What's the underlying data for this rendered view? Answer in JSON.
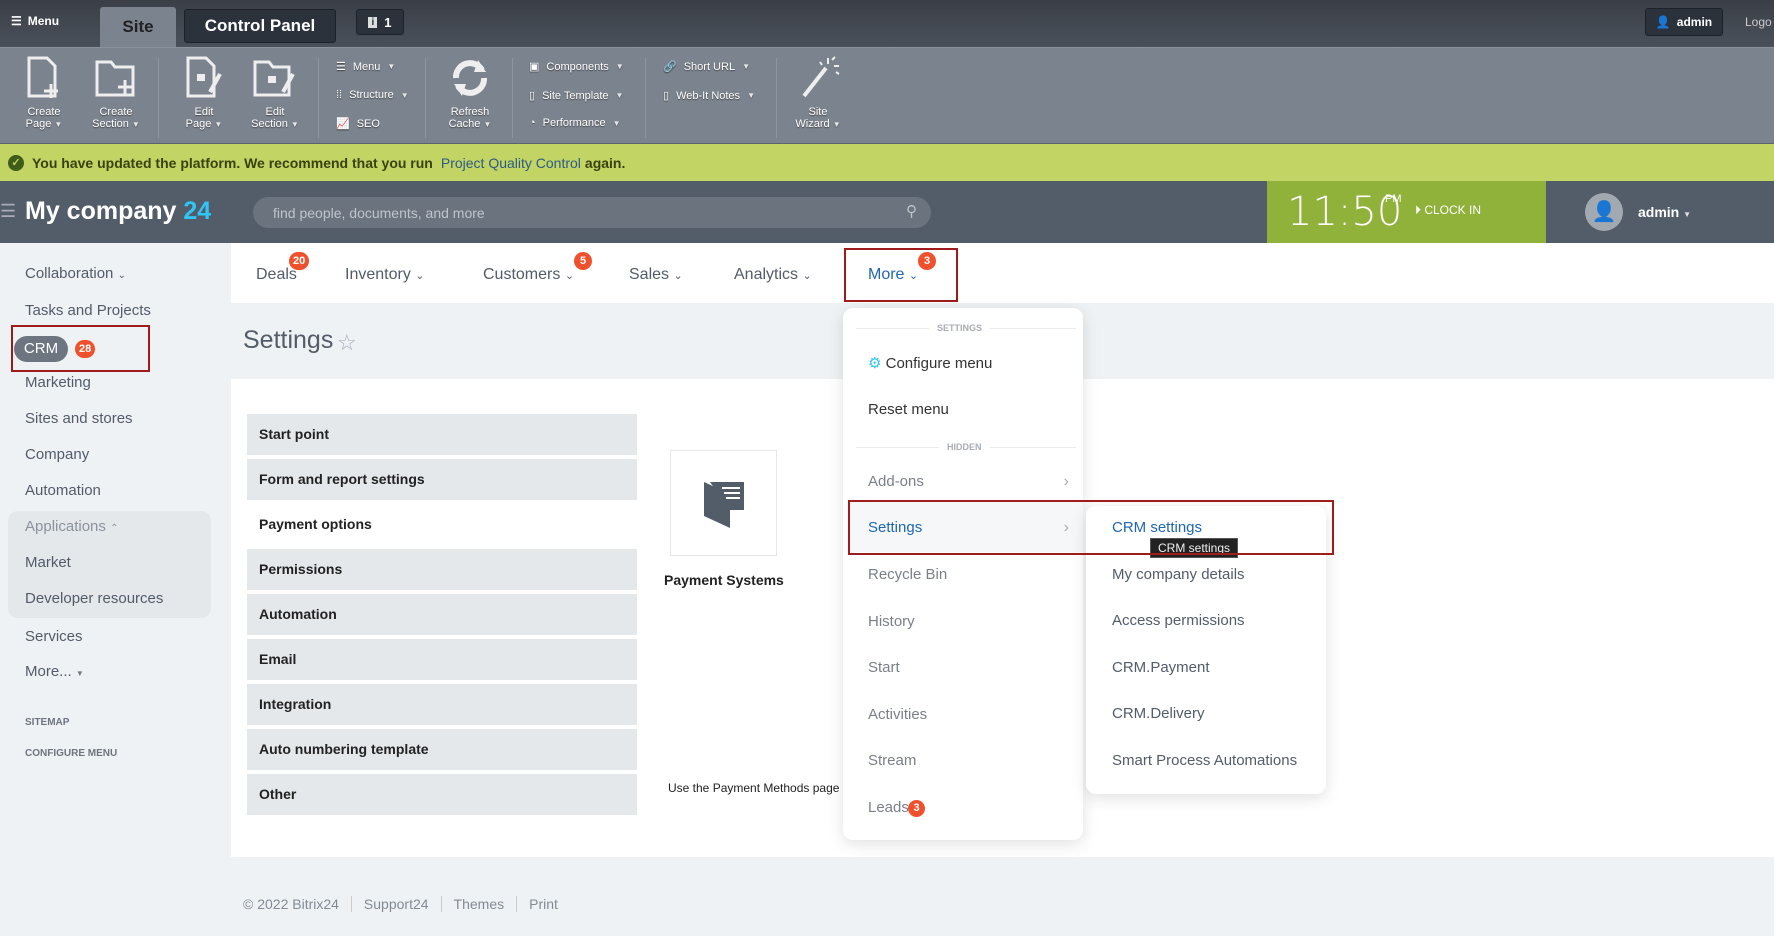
{
  "admin_bar": {
    "menu": "Menu",
    "tab_site": "Site",
    "tab_control_panel": "Control Panel",
    "notifications": "1",
    "user": "admin",
    "logout": "Logo"
  },
  "toolbar": {
    "create_page": [
      "Create",
      "Page"
    ],
    "create_section": [
      "Create",
      "Section"
    ],
    "edit_page": [
      "Edit",
      "Page"
    ],
    "edit_section": [
      "Edit",
      "Section"
    ],
    "menu": "Menu",
    "structure": "Structure",
    "seo": "SEO",
    "refresh_cache": [
      "Refresh",
      "Cache"
    ],
    "components": "Components",
    "site_template": "Site Template",
    "performance": "Performance",
    "short_url": "Short URL",
    "web_it_notes": "Web-It Notes",
    "site_wizard": [
      "Site",
      "Wizard"
    ]
  },
  "notice": {
    "text": "You have updated the platform. We recommend that you run",
    "link": "Project Quality Control",
    "suffix": "again."
  },
  "header": {
    "logo": "My company",
    "logo_num": "24",
    "search_placeholder": "find people, documents, and more",
    "time": "11:50",
    "ampm": "PM",
    "clock_in": "CLOCK IN",
    "user": "admin"
  },
  "sidebar": {
    "items": [
      "Collaboration",
      "Tasks and Projects",
      "CRM",
      "Marketing",
      "Sites and stores",
      "Company",
      "Automation",
      "Applications",
      "Market",
      "Developer resources",
      "Services",
      "More..."
    ],
    "crm_badge": "28",
    "sitemap": "SITEMAP",
    "configure": "CONFIGURE MENU"
  },
  "nav": {
    "tabs": [
      {
        "label": "Deals",
        "badge": "20"
      },
      {
        "label": "Inventory"
      },
      {
        "label": "Customers",
        "badge": "5"
      },
      {
        "label": "Sales"
      },
      {
        "label": "Analytics"
      },
      {
        "label": "More",
        "badge": "3"
      }
    ]
  },
  "page": {
    "title": "Settings",
    "list": [
      "Start point",
      "Form and report settings",
      "Payment options",
      "Permissions",
      "Automation",
      "Email",
      "Integration",
      "Auto numbering template",
      "Other"
    ],
    "selected": "Payment options",
    "tile_label": "Payment Systems",
    "description": "Use the Payment Methods page"
  },
  "more_menu": {
    "section_settings": "SETTINGS",
    "configure": "Configure menu",
    "reset": "Reset menu",
    "section_hidden": "HIDDEN",
    "items": [
      "Add-ons",
      "Settings",
      "Recycle Bin",
      "History",
      "Start",
      "Activities",
      "Stream",
      "Leads"
    ],
    "leads_badge": "3"
  },
  "submenu": {
    "items": [
      "CRM settings",
      "My company details",
      "Access permissions",
      "CRM.Payment",
      "CRM.Delivery",
      "Smart Process Automations"
    ],
    "tooltip": "CRM settings"
  },
  "footer": {
    "copyright": "© 2022 Bitrix24",
    "links": [
      "Support24",
      "Themes",
      "Print"
    ]
  },
  "colors": {
    "accent": "#2067b0",
    "badge": "#f0512d",
    "clock": "#90b13a",
    "notice": "#c2d464",
    "highlight": "#a01c1c"
  }
}
